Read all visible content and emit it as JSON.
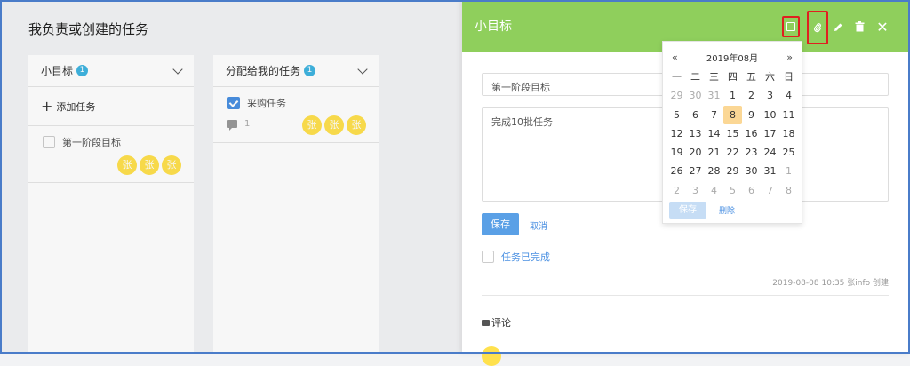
{
  "page_title": "我负责或创建的任务",
  "columns": [
    {
      "title": "小目标",
      "badge": "1",
      "add_label": "添加任务",
      "tasks": [
        {
          "title": "第一阶段目标",
          "checked": false,
          "avatars": [
            "张",
            "张",
            "张"
          ]
        }
      ]
    },
    {
      "title": "分配给我的任务",
      "badge": "1",
      "tasks": [
        {
          "title": "采购任务",
          "checked": true,
          "comments": "1",
          "avatars": [
            "张",
            "张",
            "张"
          ]
        }
      ]
    }
  ],
  "panel": {
    "title": "小目标",
    "header_color": "#8fcf5c",
    "tools": [
      "calendar-icon",
      "attachment-icon",
      "edit-icon",
      "delete-icon",
      "close-icon"
    ],
    "close_glyph": "✕",
    "task_title": "第一阶段目标",
    "task_desc": "完成10批任务",
    "save_label": "保存",
    "cancel_label": "取消",
    "done_label": "任务已完成",
    "meta": "2019-08-08 10:35 张info 创建",
    "comment_label": "评论"
  },
  "calendar": {
    "prev": "«",
    "next": "»",
    "month_label": "2019年08月",
    "weekdays": [
      "一",
      "二",
      "三",
      "四",
      "五",
      "六",
      "日"
    ],
    "days": [
      [
        "29",
        "30",
        "31",
        "1",
        "2",
        "3",
        "4"
      ],
      [
        "5",
        "6",
        "7",
        "8",
        "9",
        "10",
        "11"
      ],
      [
        "12",
        "13",
        "14",
        "15",
        "16",
        "17",
        "18"
      ],
      [
        "19",
        "20",
        "21",
        "22",
        "23",
        "24",
        "25"
      ],
      [
        "26",
        "27",
        "28",
        "29",
        "30",
        "31",
        "1"
      ],
      [
        "2",
        "3",
        "4",
        "5",
        "6",
        "7",
        "8"
      ]
    ],
    "selected": "8",
    "save_label": "保存",
    "delete_label": "删除"
  }
}
